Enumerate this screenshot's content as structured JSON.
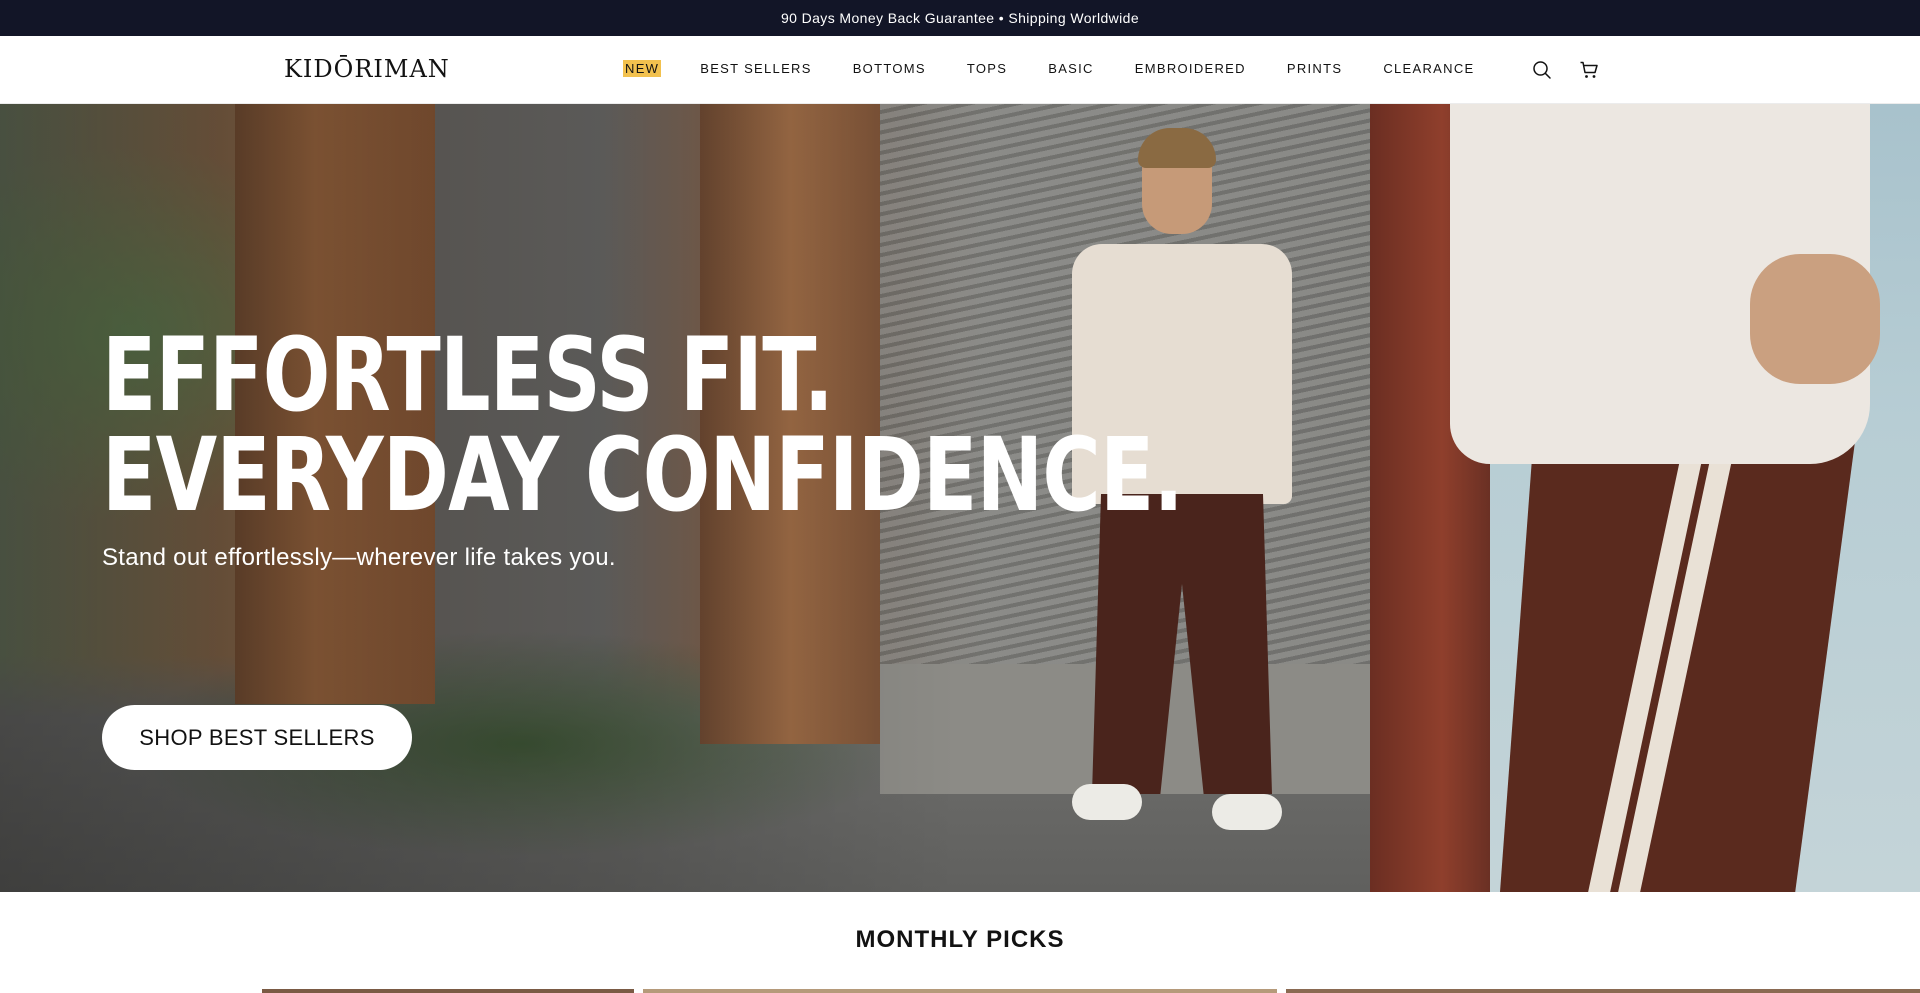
{
  "announcement": "90 Days Money Back Guarantee • Shipping Worldwide",
  "header": {
    "logo": "KIDŌRIMAN",
    "nav": [
      {
        "label": "NEW",
        "highlight": "#f2c14e"
      },
      {
        "label": "BEST SELLERS"
      },
      {
        "label": "BOTTOMS"
      },
      {
        "label": "TOPS"
      },
      {
        "label": "BASIC"
      },
      {
        "label": "EMBROIDERED"
      },
      {
        "label": "PRINTS"
      },
      {
        "label": "CLEARANCE"
      }
    ],
    "icons": {
      "search": "search-icon",
      "cart": "cart-icon"
    }
  },
  "hero": {
    "title_line1": "EFFORTLESS FIT.",
    "title_line2": "EVERYDAY CONFIDENCE.",
    "subtitle": "Stand out effortlessly—wherever life takes you.",
    "cta": "SHOP BEST SELLERS"
  },
  "section": {
    "title": "MONTHLY PICKS"
  },
  "colors": {
    "announcement_bg": "#121527",
    "accent_new": "#f2c14e",
    "text": "#121212"
  }
}
